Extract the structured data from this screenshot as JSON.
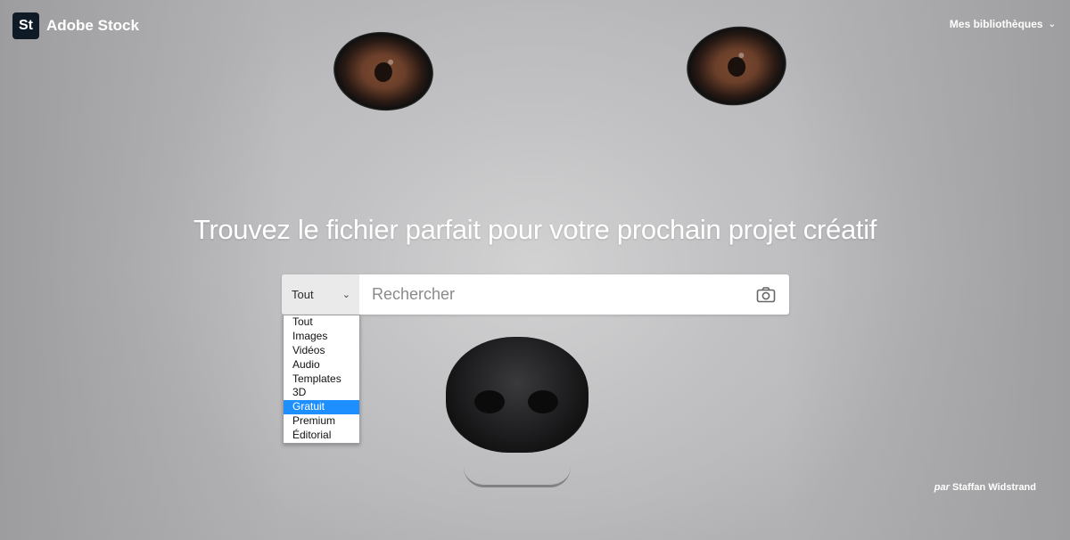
{
  "header": {
    "logo_badge": "St",
    "logo_text": "Adobe Stock",
    "libraries_label": "Mes bibliothèques"
  },
  "hero": {
    "headline": "Trouvez le fichier parfait pour votre prochain projet créatif",
    "credit_prefix": "par",
    "credit_name": "Staffan Widstrand"
  },
  "search": {
    "type_selected": "Tout",
    "placeholder": "Rechercher",
    "type_options": [
      "Tout",
      "Images",
      "Vidéos",
      "Audio",
      "Templates",
      "3D",
      "Gratuit",
      "Premium",
      "Éditorial"
    ],
    "highlighted_option": "Gratuit",
    "highlight_color": "#1e8fff"
  },
  "icons": {
    "logo": "adobe-stock-logo",
    "libraries_chevron": "chevron-down-icon",
    "select_chevron": "chevron-down-icon",
    "visual_search": "camera-icon"
  }
}
